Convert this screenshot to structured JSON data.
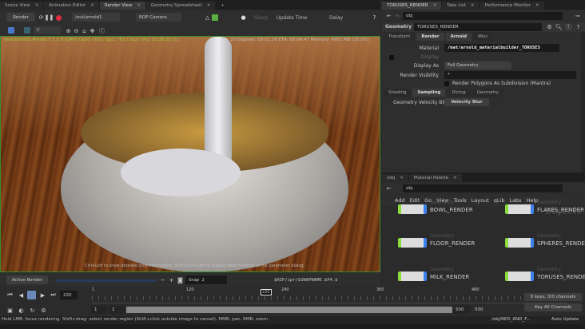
{
  "left_tabs": [
    "Scene View",
    "Animation Editor",
    "Render View",
    "Geometry Spreadsheet"
  ],
  "render_toolbar": {
    "render_label": "Render",
    "rop_path": "/out/arnold1",
    "camera": "ROP Camera",
    "sharp": "Sharp",
    "update_time": "Update Time",
    "delay": "Delay"
  },
  "toolbar2": {
    "channel": "C"
  },
  "viewport": {
    "header_left": "/out/arnold1  Arnold 7.1.2.0 [GPU]  Ca20 / Di2 / Sp2 / Tr2 / Ss2 / Vo2  15:28:25 [1]",
    "header_right": "AA: 20  Elapsed: 00:01:36  ETA: 00:04:47  Memory: 4951 MB  (25.0%)",
    "hint": "Ctrl+Left to show detailed pixel information. Shift+Ctrl+Left to inspect base material in the parameter dialog."
  },
  "snap_row": {
    "active_render": "Active Render",
    "snap": "Snap 2",
    "snap_path": "$HIP/ipr/$SNAPNAME.$F4.$"
  },
  "timeline": {
    "frame": "220",
    "ticks": [
      "1",
      "120",
      "240",
      "360",
      "480"
    ],
    "marker": "220",
    "start": "1",
    "start2": "1",
    "end": "500",
    "end2": "500"
  },
  "status": "Hold LMB: focus rendering. Shift+drag: select render region (Shift+click outside image to cancel). MMB: pan. RMB: zoom.",
  "right_tabs": [
    "TORUSES_RENDER",
    "Take List",
    "Performance Monitor"
  ],
  "path": "obj",
  "params": {
    "node_type": "Geometry",
    "node_name": "TORUSES_RENDER",
    "tabs": [
      "Transform",
      "Render",
      "Arnold",
      "Misc"
    ],
    "material_label": "Material",
    "material": "/mat/arnold_materialbuilder_TORUSES",
    "display_label": "Display",
    "display_as_label": "Display As",
    "display_as": "Full Geometry",
    "render_visibility_label": "Render Visibility",
    "render_visibility": "*",
    "subdiv_label": "Render Polygons As Subdivision (Mantra)",
    "subtabs": [
      "Shading",
      "Sampling",
      "Dicing",
      "Geometry"
    ],
    "vel_blur_label": "Geometry Velocity Blur",
    "vel_blur": "Velocity Blur"
  },
  "network_tabs": [
    "/obj",
    "Material Palette"
  ],
  "network_path": "obj",
  "menu": [
    "Add",
    "Edit",
    "Go",
    "View",
    "Tools",
    "Layout",
    "qLib",
    "Labs",
    "Help"
  ],
  "context_label": "Objects",
  "nodes": [
    {
      "type": "Geometry",
      "name": "BOWL_RENDER"
    },
    {
      "type": "Geometry",
      "name": "FLAKES_RENDER"
    },
    {
      "type": "Geometry",
      "name": "FLOOR_RENDER"
    },
    {
      "type": "Geometry",
      "name": "SPHERES_RENDER"
    },
    {
      "type": "Geometry",
      "name": "MILK_RENDER"
    },
    {
      "type": "Geometry",
      "name": "TORUSES_RENDER"
    }
  ],
  "keys": {
    "channels": "0 keys, 0/0 channels",
    "key_all": "Key All Channels"
  },
  "bottom_right": {
    "path": "/obj/RED_AND_F...",
    "auto_update": "Auto Update"
  }
}
